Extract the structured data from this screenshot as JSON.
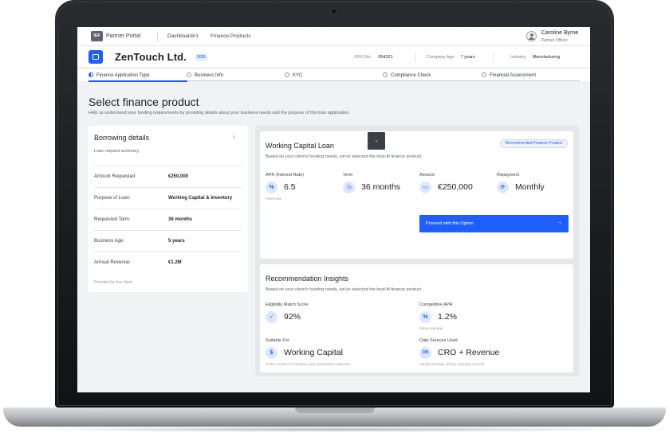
{
  "topbar": {
    "logo_text": "IEF",
    "portal": "Partner Portal",
    "nav": [
      "Dashboard#1",
      "Finance Products"
    ],
    "user_name": "Caroline Byrne",
    "user_role": "Partner Officer"
  },
  "company": {
    "name": "ZenTouch Ltd.",
    "badge": "B2B",
    "cro_label": "CRO No.",
    "cro_value": "654321",
    "age_label": "Company Age",
    "age_value": "7 years",
    "industry_label": "Industry",
    "industry_value": "Manufacturing"
  },
  "steps": [
    "Finance Application Type",
    "Business Info",
    "KYC",
    "Compliance Check",
    "Financial Assessment"
  ],
  "page": {
    "title": "Select finance product",
    "subtitle": "Help us understand your funding requirements by providing details about your business needs and the purpose of this loan application."
  },
  "borrowing": {
    "title": "Borrowing details",
    "more": "⋮",
    "subtitle": "Loan request summary",
    "rows": [
      {
        "label": "Amount Requested:",
        "value": "€250,000"
      },
      {
        "label": "Purpose of Loan:",
        "value": "Working Capital & Inventory"
      },
      {
        "label": "Requested Term:",
        "value": "36 months"
      },
      {
        "label": "Business Age:",
        "value": "5 years"
      },
      {
        "label": "Annual Revenue:",
        "value": "€1.2M"
      }
    ],
    "footer": "Provided by the client."
  },
  "loan": {
    "title": "Working Capital Loan",
    "badge": "Recommended Finance Product",
    "description": "Based on your client's funding needs, we've selected the best-fit finance product.",
    "apr_label": "APR (Interest Rate)",
    "apr_value": "6.5",
    "apr_note": "Fixed rate",
    "apr_icon": "%",
    "term_label": "Term",
    "term_value": "36 months",
    "term_icon": "◷",
    "amount_label": "Amount",
    "amount_value": "€250,000",
    "amount_icon": "▭",
    "repay_label": "Repayment",
    "repay_value": "Monthly",
    "repay_icon": "⟳",
    "proceed_label": "Proceed with this Option",
    "proceed_arrow": "→",
    "expand_icon": "⌄"
  },
  "insights": {
    "title": "Recommendation Insights",
    "description": "Based on your client's funding needs, we've selected the best-fit finance product.",
    "elig_label": "Eligibility Match Score",
    "elig_value": "92%",
    "elig_icon": "✓",
    "apr_label": "Competitive APR",
    "apr_value": "1.2%",
    "apr_note": "below average",
    "apr_icon": "%",
    "suit_label": "Suitable For",
    "suit_value": "Working Capital",
    "suit_note": "Perfect match for inventory and operational expenses",
    "suit_icon": "$",
    "src_label": "Data Sources Used",
    "src_value": "CRO + Revenue",
    "src_note": "Verified through official company records",
    "src_icon": "DB"
  },
  "colors": {
    "accent": "#1f5eff",
    "bg": "#f1f2f4",
    "card": "#ffffff",
    "dark_button": "#3c3f45"
  }
}
